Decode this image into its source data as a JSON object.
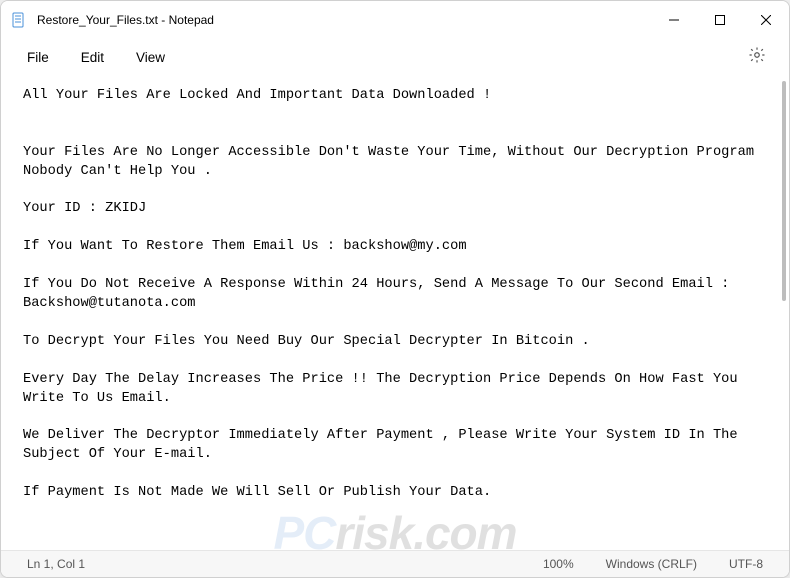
{
  "window": {
    "title": "Restore_Your_Files.txt - Notepad"
  },
  "menu": {
    "file": "File",
    "edit": "Edit",
    "view": "View"
  },
  "document": {
    "body": "All Your Files Are Locked And Important Data Downloaded !\n\n\nYour Files Are No Longer Accessible Don't Waste Your Time, Without Our Decryption Program Nobody Can't Help You .\n\nYour ID : ZKIDJ\n\nIf You Want To Restore Them Email Us : backshow@my.com\n\nIf You Do Not Receive A Response Within 24 Hours, Send A Message To Our Second Email : Backshow@tutanota.com\n\nTo Decrypt Your Files You Need Buy Our Special Decrypter In Bitcoin .\n\nEvery Day The Delay Increases The Price !! The Decryption Price Depends On How Fast You Write To Us Email.\n\nWe Deliver The Decryptor Immediately After Payment , Please Write Your System ID In The Subject Of Your E-mail.\n\nIf Payment Is Not Made We Will Sell Or Publish Your Data."
  },
  "status": {
    "cursor": "Ln 1, Col 1",
    "zoom": "100%",
    "lineend": "Windows (CRLF)",
    "encoding": "UTF-8"
  },
  "watermark": {
    "text_pc": "PC",
    "text_rest": "risk.com"
  }
}
